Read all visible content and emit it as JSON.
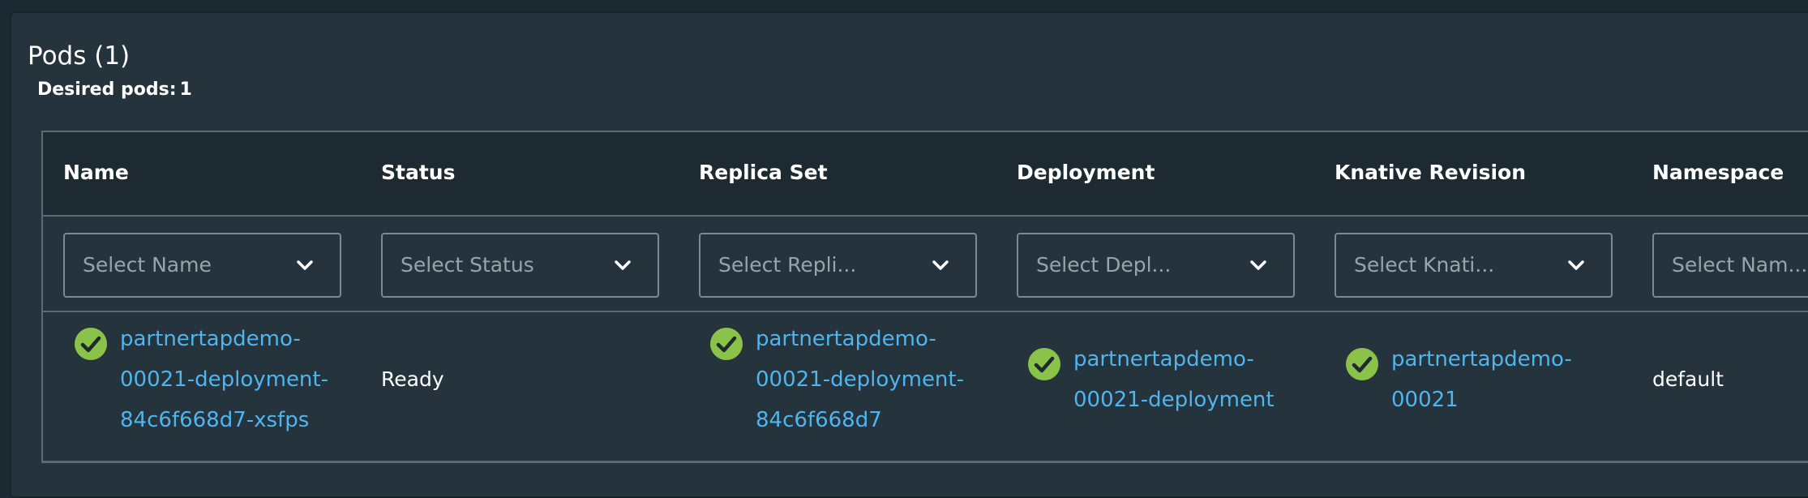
{
  "panel": {
    "title": "Pods (1)",
    "desired_label": "Desired pods:",
    "desired_value": "1"
  },
  "table": {
    "columns": [
      {
        "header": "Name",
        "filter_placeholder": "Select Name"
      },
      {
        "header": "Status",
        "filter_placeholder": "Select Status"
      },
      {
        "header": "Replica Set",
        "filter_placeholder": "Select Repli..."
      },
      {
        "header": "Deployment",
        "filter_placeholder": "Select Depl..."
      },
      {
        "header": "Knative Revision",
        "filter_placeholder": "Select Knati..."
      },
      {
        "header": "Namespace",
        "filter_placeholder": "Select Nam..."
      }
    ],
    "rows": [
      {
        "name_lines": [
          "partnertapdemo-",
          "00021-deployment-",
          "84c6f668d7-xsfps"
        ],
        "status": "Ready",
        "replica_set_lines": [
          "partnertapdemo-",
          "00021-deployment-",
          "84c6f668d7"
        ],
        "deployment_lines": [
          "partnertapdemo-",
          "00021-deployment"
        ],
        "knative_revision_lines": [
          "partnertapdemo-",
          "00021"
        ],
        "namespace": "default"
      }
    ]
  },
  "colors": {
    "background": "#25333d",
    "header_bg": "#1d2a31",
    "link": "#4fb5ee",
    "success": "#8bc34a",
    "border": "#5d6a72"
  },
  "icons": {
    "success": "check-circle-icon",
    "dropdown": "chevron-down-icon"
  }
}
